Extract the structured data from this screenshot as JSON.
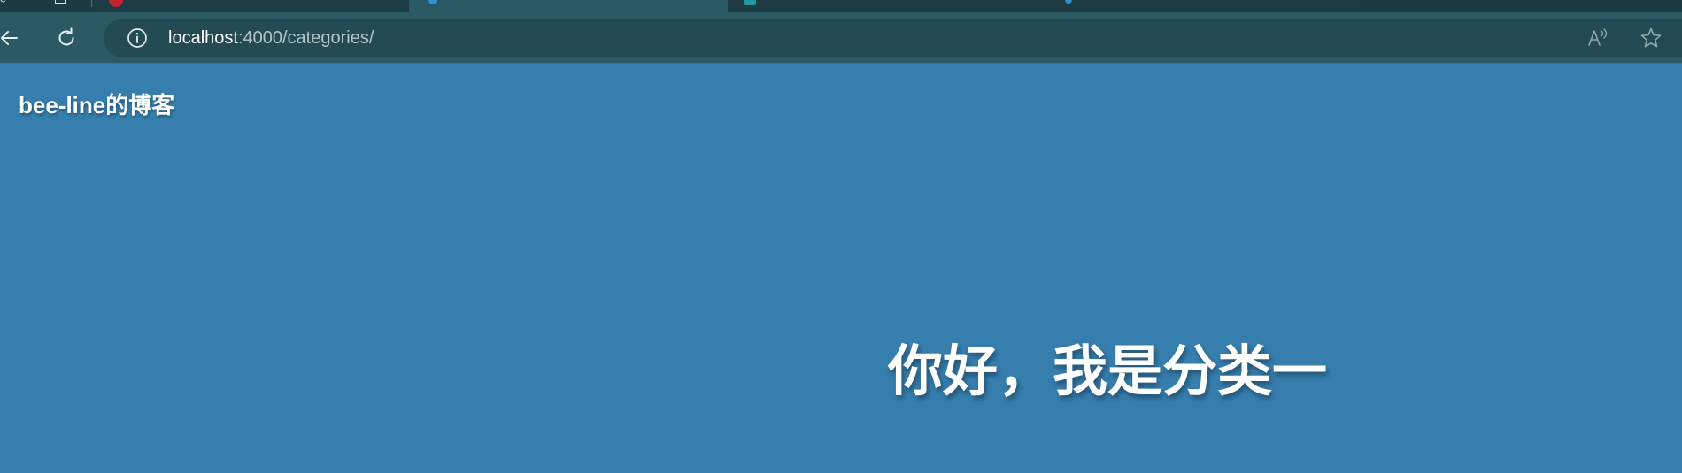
{
  "browser": {
    "url": {
      "host": "localhost",
      "rest": ":4000/categories/"
    },
    "icons": {
      "back": "arrow-left-icon",
      "refresh": "refresh-icon",
      "site_info": "info-circle-icon",
      "read_aloud": "read-aloud-icon",
      "favorite": "star-icon"
    }
  },
  "page": {
    "site_title": "bee-line的博客",
    "heading": "你好，我是分类一"
  },
  "colors": {
    "page_background": "#367eae",
    "toolbar_background": "#2b5a64",
    "addressbar_background": "#244a54",
    "text": "#ffffff"
  }
}
